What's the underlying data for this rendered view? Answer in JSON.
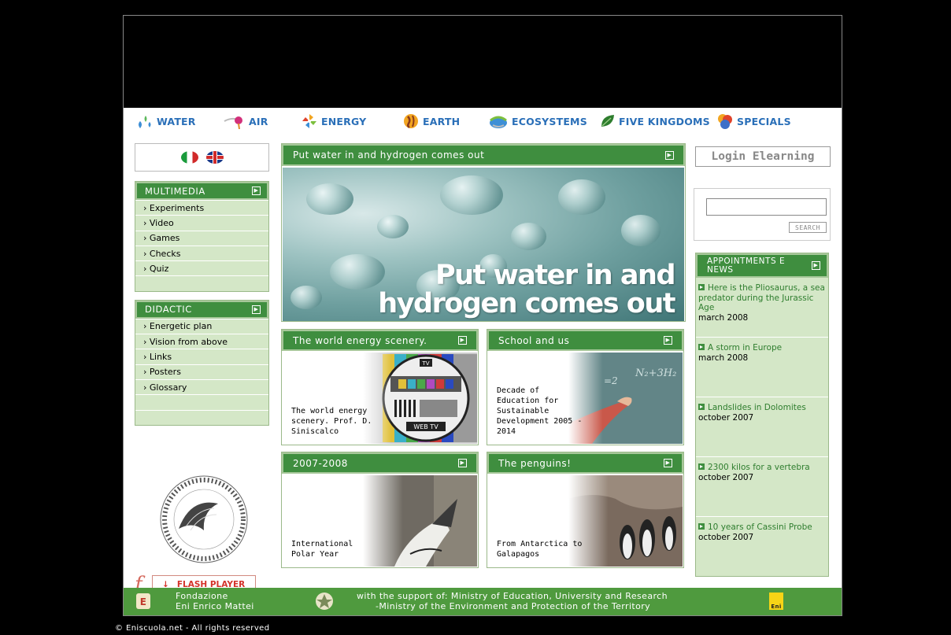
{
  "nav": [
    {
      "label": "WATER",
      "icon": "water-drops-icon"
    },
    {
      "label": "AIR",
      "icon": "air-swirl-icon"
    },
    {
      "label": "ENERGY",
      "icon": "energy-pinwheel-icon"
    },
    {
      "label": "EARTH",
      "icon": "earth-globe-icon"
    },
    {
      "label": "ECOSYSTEMS",
      "icon": "ecosystem-icon"
    },
    {
      "label": "FIVE KINGDOMS",
      "icon": "leaf-icon"
    },
    {
      "label": "SPECIALS",
      "icon": "specials-circles-icon"
    }
  ],
  "languages": [
    "italian-flag-icon",
    "uk-flag-icon"
  ],
  "multimedia": {
    "title": "MULTIMEDIA",
    "items": [
      "› Experiments",
      "› Video",
      "› Games",
      "› Checks",
      "› Quiz"
    ]
  },
  "didactic": {
    "title": "DIDACTIC",
    "items": [
      "› Energetic plan",
      "› Vision from above",
      "› Links",
      "› Posters",
      "› Glossary"
    ]
  },
  "flash": {
    "label": "FLASH PLAYER"
  },
  "feature": {
    "header": "Put water in and hydrogen comes out",
    "image_title_line1": "Put water in and",
    "image_title_line2": "hydrogen comes out"
  },
  "cards": [
    {
      "header": "The world energy scenery.",
      "text": "The world energy scenery. Prof. D. Siniscalco"
    },
    {
      "header": "School and us",
      "text": "Decade of Education for Sustainable Development 2005 - 2014"
    },
    {
      "header": "2007-2008",
      "text": "International Polar Year"
    },
    {
      "header": "The penguins!",
      "text": "From Antarctica to Galapagos"
    }
  ],
  "login": {
    "label": "Login Elearning"
  },
  "search": {
    "value": "",
    "button": "SEARCH"
  },
  "news": {
    "title_line1": "APPOINTMENTS E",
    "title_line2": "NEWS",
    "items": [
      {
        "title": "Here is the Pliosaurus, a sea predator during the Jurassic Age",
        "date": "march 2008"
      },
      {
        "title": "A storm in Europe",
        "date": "march 2008"
      },
      {
        "title": "Landslides in Dolomites",
        "date": "october 2007"
      },
      {
        "title": "2300 kilos for a vertebra",
        "date": "october 2007"
      },
      {
        "title": "10 years of Cassini Probe",
        "date": "october 2007"
      }
    ]
  },
  "footer": {
    "foundation_line1": "Fondazione",
    "foundation_line2": "Eni Enrico Mattei",
    "support_line1": "with the support of: Ministry of Education, University and Research",
    "support_line2": "-Ministry of the Environment and Protection of the Territory",
    "eni_logo_text": "Eni"
  },
  "copyright": "© Eniscuola.net - All rights reserved",
  "colors": {
    "accent_green": "#3f8e3f",
    "light_green": "#d4e7c7",
    "nav_blue": "#2a6fb8",
    "flash_red": "#d4332a"
  }
}
